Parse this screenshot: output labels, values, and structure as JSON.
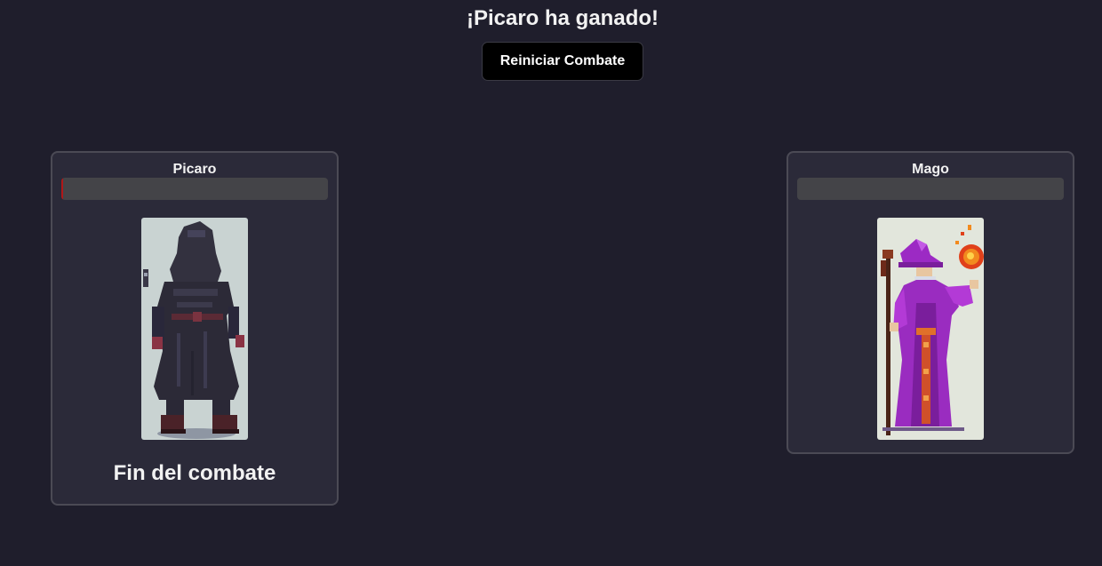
{
  "header": {
    "result_text": "¡Picaro ha ganado!",
    "restart_label": "Reiniciar Combate"
  },
  "fighters": [
    {
      "name": "Picaro",
      "hp_fraction": 0.0,
      "status_text": "Fin del combate",
      "portrait_icon": "hooded-rogue-pixel-icon"
    },
    {
      "name": "Mago",
      "hp_fraction": 0.0,
      "portrait_icon": "wizard-fireball-pixel-icon"
    }
  ],
  "colors": {
    "background": "#1f1e2c",
    "card": "#2b2a39",
    "hp_track": "#444448",
    "hp_fill": "#b01818"
  }
}
